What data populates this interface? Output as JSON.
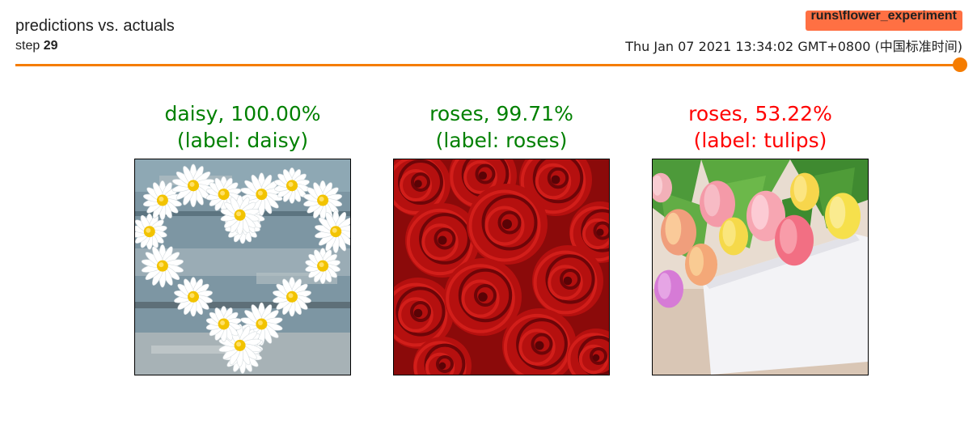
{
  "card": {
    "title": "predictions vs. actuals",
    "step_label": "step",
    "step_value": "29",
    "run_name": "runs\\flower_experiment",
    "wall_time": "Thu Jan 07 2021 13:34:02 GMT+0800 (中国标准时间)"
  },
  "slider": {
    "fraction": 1.0
  },
  "colors": {
    "accent": "#f57c00",
    "run_badge": "#ff7043",
    "correct": "#008000",
    "incorrect": "#ff0000"
  },
  "predictions": [
    {
      "pred": "daisy, 100.00%",
      "label": "(label: daisy)",
      "correct": true,
      "image": "daisy-heart-photo"
    },
    {
      "pred": "roses, 99.71%",
      "label": "(label: roses)",
      "correct": true,
      "image": "red-roses-photo"
    },
    {
      "pred": "roses, 53.22%",
      "label": "(label: tulips)",
      "correct": false,
      "image": "tulips-and-card-photo"
    }
  ]
}
